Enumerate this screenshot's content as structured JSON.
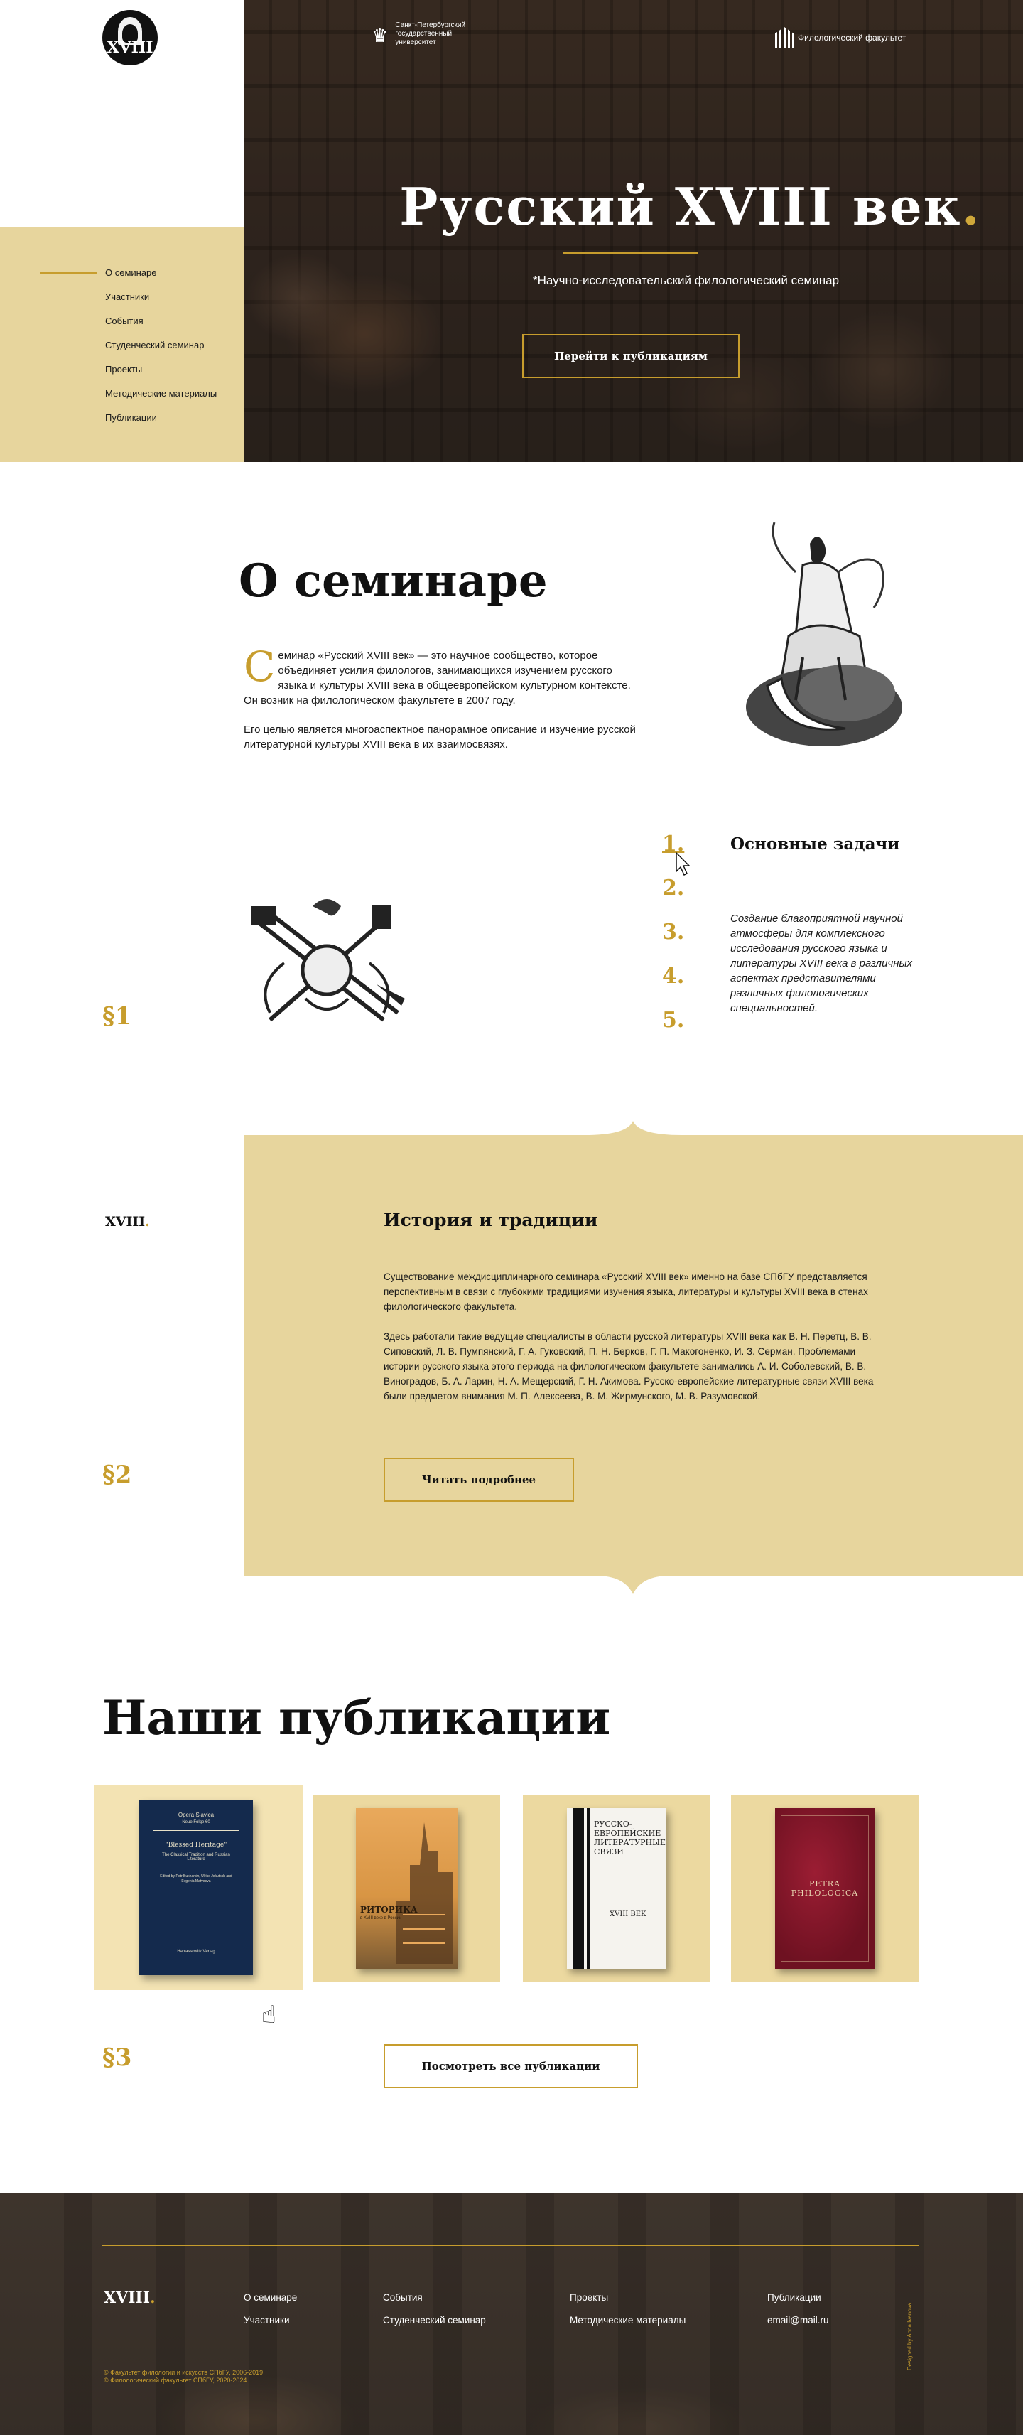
{
  "logo": {
    "text": "XVIII"
  },
  "nav": {
    "items": [
      {
        "label": "О семинаре"
      },
      {
        "label": "Участники"
      },
      {
        "label": "События"
      },
      {
        "label": "Студенческий семинар"
      },
      {
        "label": "Проекты"
      },
      {
        "label": "Методические материалы"
      },
      {
        "label": "Публикации"
      }
    ],
    "active_index": 0
  },
  "hero": {
    "university": "Санкт-Петербургский государственный университет",
    "faculty": "Филологический факультет",
    "title": "Русский XVIII век",
    "title_dot": ".",
    "subtitle": "*Научно-исследовательский филологический семинар",
    "button": "Перейти к публикациям"
  },
  "about": {
    "title": "О семинаре",
    "dropcap": "С",
    "paragraph1": "еминар «Русский XVIII век» — это научное сообщество, которое объединяет усилия филологов, занимающихся изучением русского языка и культуры XVIII века в общеевропейском культурном контексте. Он возник на филологическом факультете в 2007 году.",
    "paragraph2": "Его целью является многоаспектное панорамное описание и изучение русской литературной культуры XVIII века в их взаимосвязях."
  },
  "tasks": {
    "title": "Основные задачи",
    "numbers": [
      "1.",
      "2.",
      "3.",
      "4.",
      "5."
    ],
    "active": 1,
    "description": "Создание благоприятной научной атмосферы для комплексного исследования русского языка и литературы XVIII века в различных аспектах представителями различных филологических специальностей."
  },
  "sections": {
    "s1": "§1",
    "s2": "§2",
    "s3": "§3"
  },
  "history": {
    "logo": "XVIII",
    "logo_dot": ".",
    "title": "История и традиции",
    "paragraph1": "Существование междисциплинарного семинара «Русский XVIII век» именно на базе СПбГУ представляется перспективным в связи с глубокими традициями изучения языка, литературы и культуры XVIII века в стенах филологического факультета.",
    "paragraph2": "Здесь работали такие ведущие специалисты в области русской литературы XVIII века как В. Н. Перетц, В. В. Сиповский, Л. В. Пумпянский, Г. А. Гуковский, П. Н. Берков, Г. П. Макогоненко, И. З. Серман. Проблемами истории русского языка этого периода на филологическом факультете занимались А. И. Соболевский, В. В. Виноградов, Б. А. Ларин, Н. А. Мещерский, Г. Н. Акимова. Русско-европейские литературные связи XVIII века были предметом внимания М. П. Алексеева, В. М. Жирмунского, М. В. Разумовской.",
    "button": "Читать подробнее"
  },
  "publications": {
    "title": "Наши публикации",
    "books": [
      {
        "series": "Opera Slavica",
        "series_sub": "Neue Folge 60",
        "title": "\"Blessed Heritage\"",
        "subtitle": "The Classical Tradition and Russian Literature",
        "editors": "Edited by Petr Bukharkin, Ulrike Jekutsch and Evgenia Matveeva",
        "publisher": "Harrassowitz Verlag"
      },
      {
        "title": "РИТОРИКА",
        "subtitle": "в XVIII веке в России"
      },
      {
        "title": "РУССКО-ЕВРОПЕЙСКИЕ ЛИТЕРАТУРНЫЕ СВЯЗИ",
        "subtitle": "XVIII ВЕК"
      },
      {
        "title": "PETRA PHILOLOGICA"
      }
    ],
    "button": "Посмотреть все публикации"
  },
  "footer": {
    "logo": "XVIII",
    "logo_dot": ".",
    "links": {
      "col1": [
        "О семинаре",
        "Участники"
      ],
      "col2": [
        "События",
        "Студенческий семинар"
      ],
      "col3": [
        "Проекты",
        "Методические материалы"
      ],
      "col4": [
        "Публикации",
        "email@mail.ru"
      ]
    },
    "copyright1": "© Факультет филологии и искусств СПбГУ, 2006-2019",
    "copyright2": "© Филологический факультет СПбГУ, 2020-2024",
    "credit": "Designed by Anna Ivanova"
  },
  "colors": {
    "gold": "#c79d2d",
    "sand": "#e7d59d",
    "dark": "#3c3029"
  }
}
